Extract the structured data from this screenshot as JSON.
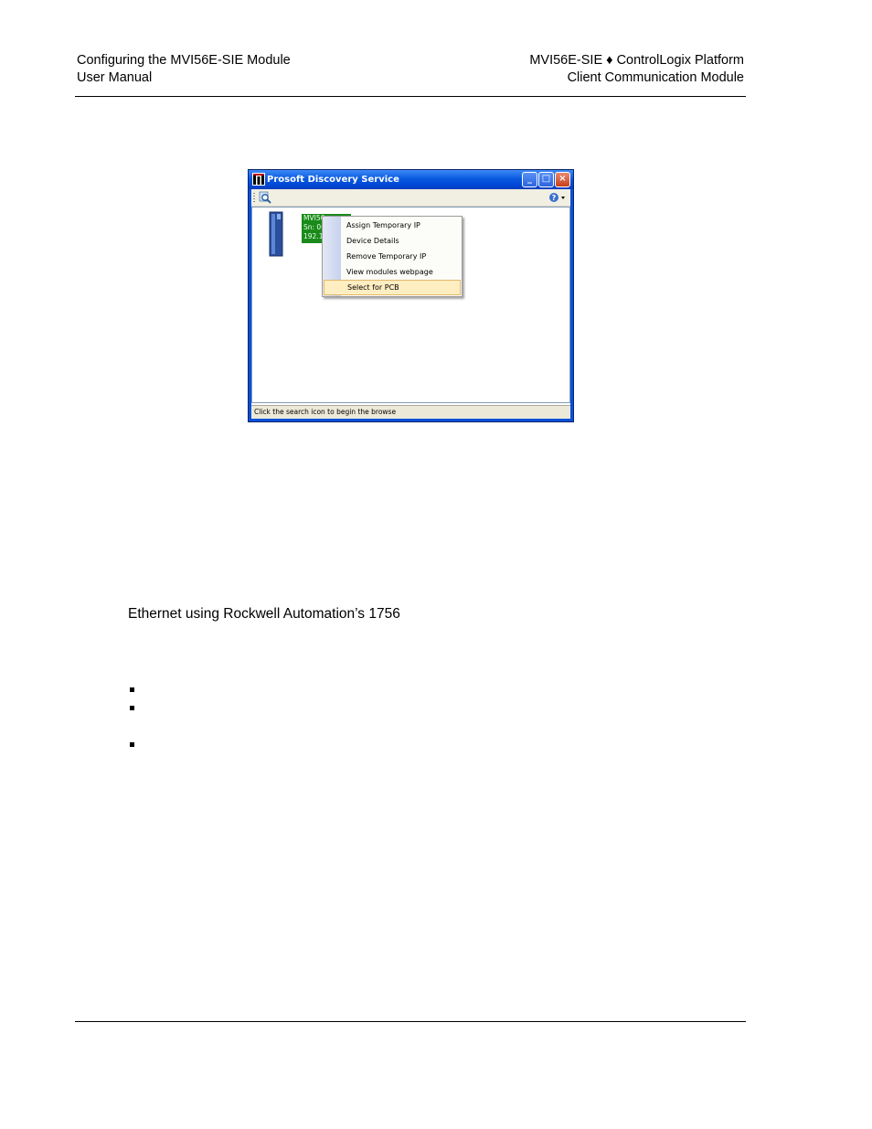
{
  "header": {
    "left_line1": "Configuring the MVI56E-SIE Module",
    "left_line2": "User Manual",
    "right_line1": "MVI56E-SIE ♦ ControlLogix Platform",
    "right_line2": "Client Communication Module"
  },
  "window": {
    "title": "Prosoft Discovery Service",
    "minimize": "_",
    "maximize": "□",
    "close": "×",
    "device_label": [
      "MVI56",
      "Sn: 00",
      "192.16"
    ],
    "status": "Click the search icon to begin the browse"
  },
  "context_menu": {
    "items": [
      "Assign Temporary IP",
      "Device Details",
      "Remove Temporary IP",
      "View modules webpage",
      "Select for PCB"
    ],
    "selected_index": 4
  },
  "body": {
    "text": "Ethernet using Rockwell Automation’s 1756"
  }
}
